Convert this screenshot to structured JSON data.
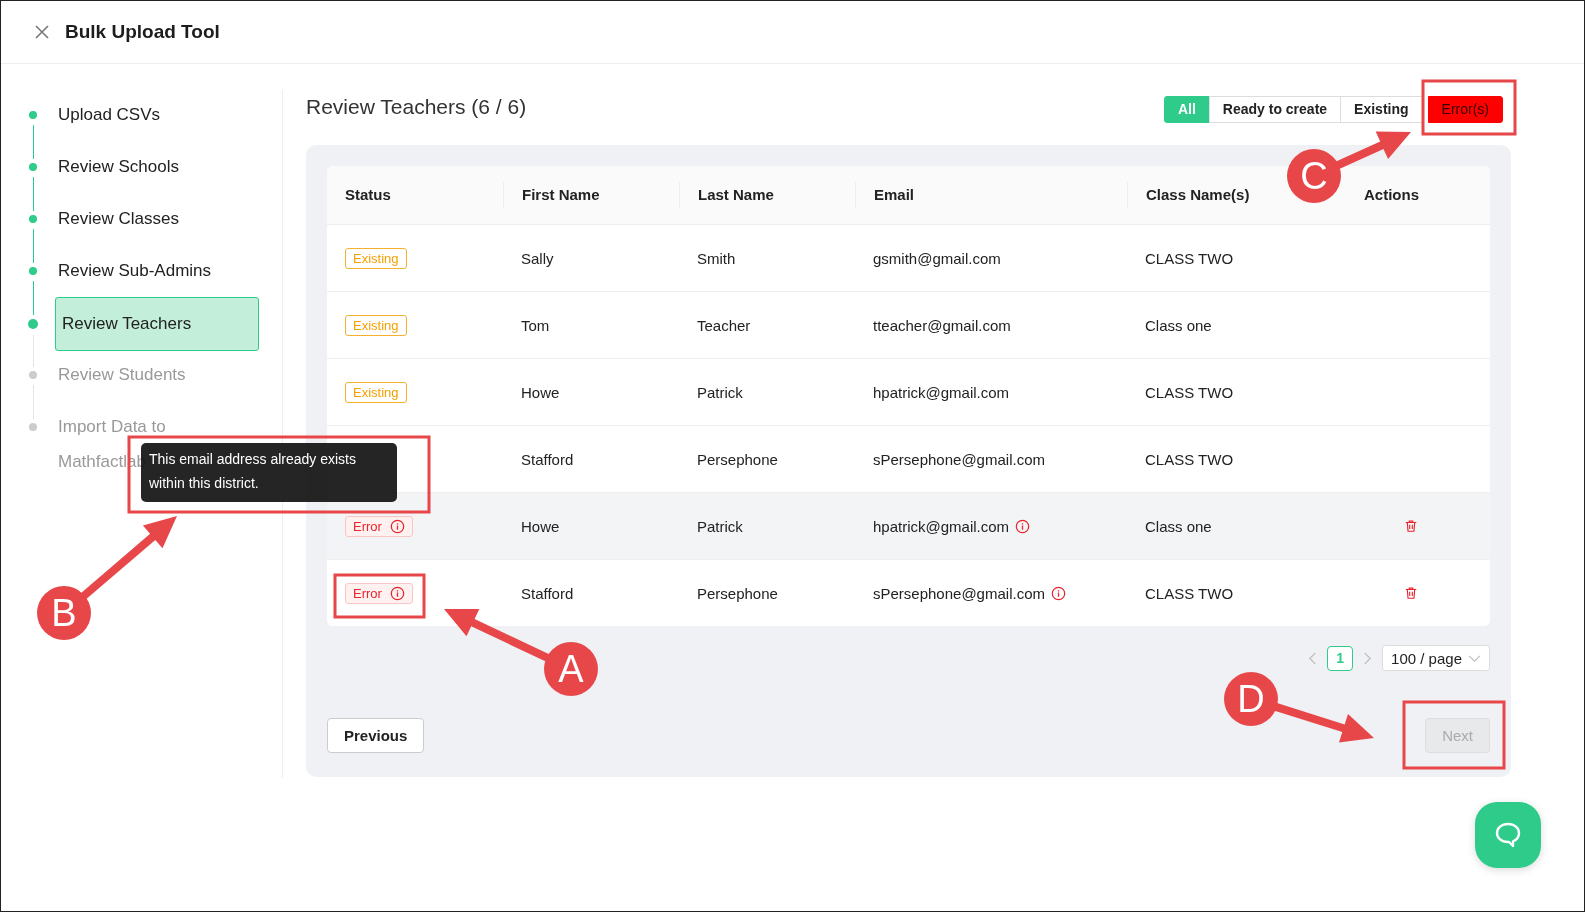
{
  "window": {
    "title": "Bulk Upload Tool"
  },
  "steps": [
    {
      "label": "Upload CSVs",
      "completed": true,
      "selected": false
    },
    {
      "label": "Review Schools",
      "completed": true,
      "selected": false
    },
    {
      "label": "Review Classes",
      "completed": true,
      "selected": false
    },
    {
      "label": "Review Sub-Admins",
      "completed": true,
      "selected": false
    },
    {
      "label": "Review Teachers",
      "completed": true,
      "selected": true
    },
    {
      "label": "Review Students",
      "completed": false,
      "selected": false
    },
    {
      "label": "Import Data to Mathfactlab",
      "completed": false,
      "selected": false
    }
  ],
  "page_title": "Review Teachers (6 / 6)",
  "filters": [
    {
      "label": "All",
      "kind": "all",
      "selected": true
    },
    {
      "label": "Ready to create",
      "kind": "ready",
      "selected": false
    },
    {
      "label": "Existing",
      "kind": "existing",
      "selected": false
    },
    {
      "label": "Error(s)",
      "kind": "error",
      "selected": false
    }
  ],
  "table": {
    "columns": [
      "Status",
      "First Name",
      "Last Name",
      "Email",
      "Class Name(s)",
      "Actions"
    ],
    "rows": [
      {
        "status": {
          "kind": "existing",
          "label": "Existing"
        },
        "first": "Sally",
        "last": "Smith",
        "email": "gsmith@gmail.com",
        "email_error": false,
        "class": "CLASS TWO",
        "deletable": false,
        "hovered": false
      },
      {
        "status": {
          "kind": "existing",
          "label": "Existing"
        },
        "first": "Tom",
        "last": "Teacher",
        "email": "tteacher@gmail.com",
        "email_error": false,
        "class": "Class one",
        "deletable": false,
        "hovered": false
      },
      {
        "status": {
          "kind": "existing",
          "label": "Existing"
        },
        "first": "Howe",
        "last": "Patrick",
        "email": "hpatrick@gmail.com",
        "email_error": false,
        "class": "CLASS TWO",
        "deletable": false,
        "hovered": false
      },
      {
        "status": {
          "kind": "hidden"
        },
        "first": "Stafford",
        "last": "Persephone",
        "email": "sPersephone@gmail.com",
        "email_error": false,
        "class": "CLASS TWO",
        "deletable": false,
        "hovered": false
      },
      {
        "status": {
          "kind": "error",
          "label": "Error"
        },
        "first": "Howe",
        "last": "Patrick",
        "email": "hpatrick@gmail.com",
        "email_error": true,
        "class": "Class one",
        "deletable": true,
        "hovered": true
      },
      {
        "status": {
          "kind": "error",
          "label": "Error"
        },
        "first": "Stafford",
        "last": "Persephone",
        "email": "sPersephone@gmail.com",
        "email_error": true,
        "class": "CLASS TWO",
        "deletable": true,
        "hovered": false
      }
    ]
  },
  "pagination": {
    "pages": [
      {
        "label": "1",
        "selected": true
      }
    ],
    "page_size": "100 / page"
  },
  "buttons": [
    {
      "label": "Previous",
      "disabled": false
    },
    {
      "label": "Next",
      "disabled": true
    }
  ],
  "tooltip": {
    "text": "This email address already exists within this district."
  },
  "annotations": [
    {
      "letter": "C"
    },
    {
      "letter": "B"
    },
    {
      "letter": "A"
    },
    {
      "letter": "D"
    }
  ]
}
